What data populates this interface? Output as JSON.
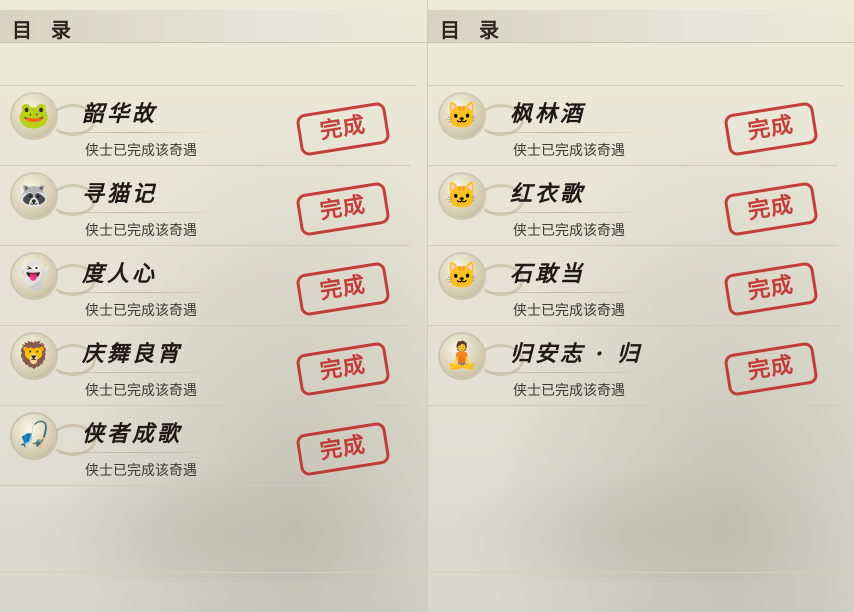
{
  "left_page": {
    "title": "目 录",
    "entries": [
      {
        "title": "韶华故",
        "status": "侠士已完成该奇遇",
        "stamp": "完成",
        "icon": "frog-icon",
        "glyph": "🐸"
      },
      {
        "title": "寻猫记",
        "status": "侠士已完成该奇遇",
        "stamp": "完成",
        "icon": "raccoon-icon",
        "glyph": "🦝"
      },
      {
        "title": "度人心",
        "status": "侠士已完成该奇遇",
        "stamp": "完成",
        "icon": "ghost-mask-icon",
        "glyph": "👻"
      },
      {
        "title": "庆舞良宵",
        "status": "侠士已完成该奇遇",
        "stamp": "完成",
        "icon": "lion-dance-icon",
        "glyph": "🦁"
      },
      {
        "title": "侠者成歌",
        "status": "侠士已完成该奇遇",
        "stamp": "完成",
        "icon": "fishing-hermit-icon",
        "glyph": "🎣"
      }
    ]
  },
  "right_page": {
    "title": "目 录",
    "entries": [
      {
        "title": "枫林酒",
        "status": "侠士已完成该奇遇",
        "stamp": "完成",
        "icon": "cat-icon",
        "glyph": "🐱"
      },
      {
        "title": "红衣歌",
        "status": "侠士已完成该奇遇",
        "stamp": "完成",
        "icon": "cat-icon",
        "glyph": "🐱"
      },
      {
        "title": "石敢当",
        "status": "侠士已完成该奇遇",
        "stamp": "完成",
        "icon": "cat-icon",
        "glyph": "🐱"
      },
      {
        "title": "归安志 · 归",
        "status": "侠士已完成该奇遇",
        "stamp": "完成",
        "icon": "golden-buddha-icon",
        "glyph": "🧘"
      }
    ]
  }
}
